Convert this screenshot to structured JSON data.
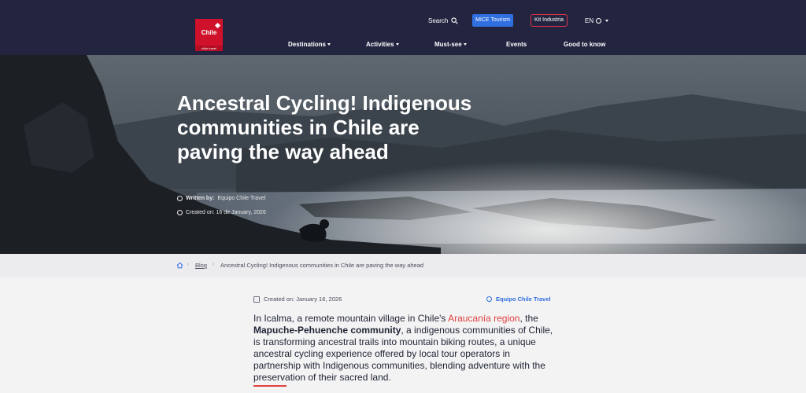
{
  "header": {
    "logo_text": "Chile",
    "logo_strip": "chile travel",
    "search_label": "Search",
    "mice_label": "MICE Tourism",
    "kit_label": "Kit Industria",
    "lang_label": "EN",
    "nav": [
      {
        "label": "Destinations",
        "has_menu": true
      },
      {
        "label": "Activities",
        "has_menu": true
      },
      {
        "label": "Must-see",
        "has_menu": true
      },
      {
        "label": "Events",
        "has_menu": false
      },
      {
        "label": "Good to know",
        "has_menu": false
      }
    ]
  },
  "hero": {
    "title": "Ancestral Cycling! Indigenous communities in Chile are paving the way ahead",
    "written_by_label": "Written by:",
    "written_by_value": "Equipo Chile Travel",
    "created_on": "Created on: 16 de January, 2026"
  },
  "breadcrumb": {
    "blog": "Blog",
    "current": "Ancestral Cycling! Indigenous communities in Chile are paving the way ahead"
  },
  "article": {
    "created_on": "Created on: January 16, 2026",
    "author": "Equipo Chile Travel",
    "p1_a": "In Icalma, a remote mountain village in Chile's ",
    "p1_link": "Araucanía region",
    "p1_b": ", the ",
    "p1_strong": "Mapuche-Pehuenche community",
    "p1_c": ", a indigenous communities of Chile, is transforming ancestral trails into mountain biking routes, a unique ancestral cycling experience offered by local tour operators in partnership with Indigenous communities, blending adventure with the preservation of their sacred land."
  },
  "colors": {
    "header_bg": "#232540",
    "brand_red": "#d0112b",
    "accent_blue": "#2f6fe0",
    "link_red": "#e0413f"
  }
}
